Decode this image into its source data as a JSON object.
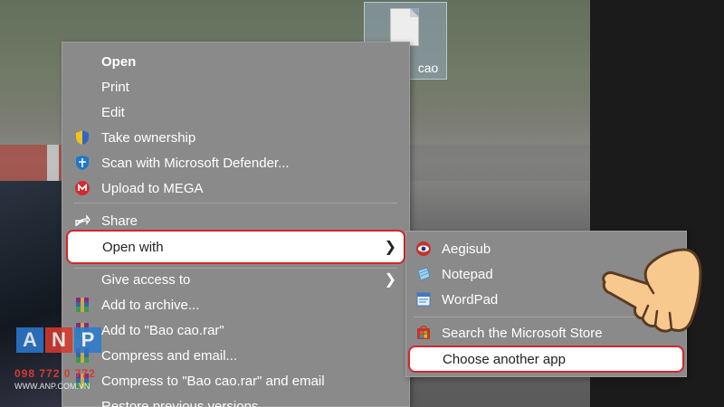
{
  "file": {
    "label": "cao"
  },
  "context_menu": {
    "items": [
      {
        "label": "Open",
        "bold": true,
        "icon": ""
      },
      {
        "label": "Print",
        "icon": ""
      },
      {
        "label": "Edit",
        "icon": ""
      },
      {
        "label": "Take ownership",
        "icon": "uac-shield-icon"
      },
      {
        "label": "Scan with Microsoft Defender...",
        "icon": "defender-icon"
      },
      {
        "label": "Upload to MEGA",
        "icon": "mega-icon"
      },
      {
        "label": "Share",
        "icon": "share-icon"
      },
      {
        "label": "Open with",
        "icon": "",
        "submenu": true,
        "highlighted": true
      },
      {
        "label": "Give access to",
        "icon": "",
        "submenu": true
      },
      {
        "label": "Add to archive...",
        "icon": "winrar-icon"
      },
      {
        "label": "Add to \"Bao cao.rar\"",
        "icon": "winrar-icon"
      },
      {
        "label": "Compress and email...",
        "icon": "winrar-icon"
      },
      {
        "label": "Compress to \"Bao cao.rar\" and email",
        "icon": "winrar-icon"
      },
      {
        "label": "Restore previous versions",
        "icon": ""
      }
    ]
  },
  "open_with_submenu": {
    "items": [
      {
        "label": "Aegisub",
        "icon": "aegisub-icon"
      },
      {
        "label": "Notepad",
        "icon": "notepad-icon"
      },
      {
        "label": "WordPad",
        "icon": "wordpad-icon"
      },
      {
        "label": "Search the Microsoft Store",
        "icon": "store-icon"
      },
      {
        "label": "Choose another app",
        "icon": "",
        "highlighted": true
      }
    ]
  },
  "watermark": {
    "letters": [
      "A",
      "N",
      "P"
    ],
    "phone": "098 772 0 772",
    "site": "WWW.ANP.COM.VN"
  },
  "colors": {
    "highlight_border": "#d8242a",
    "menu_bg": "#8a8a8a"
  }
}
